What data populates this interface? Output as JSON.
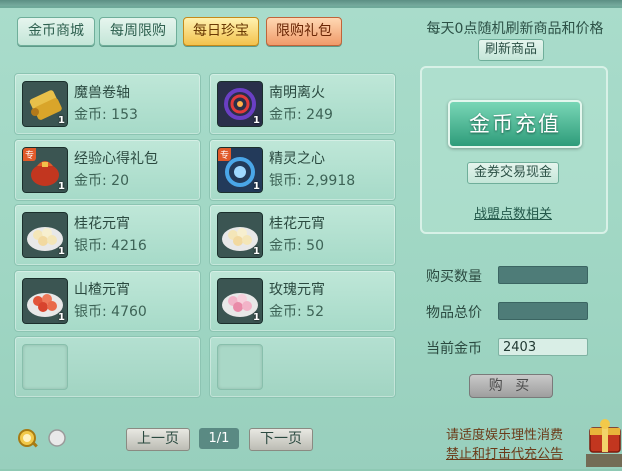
{
  "tabs": [
    {
      "label": "金币商城",
      "state": "normal"
    },
    {
      "label": "每周限购",
      "state": "normal"
    },
    {
      "label": "每日珍宝",
      "state": "active"
    },
    {
      "label": "限购礼包",
      "state": "limited"
    }
  ],
  "notice": "每天0点随机刷新商品和价格",
  "refresh_button": "刷新商品",
  "items": [
    {
      "name": "魔兽卷轴",
      "price": "金币: 153",
      "qty": "1",
      "icon": "scroll-icon"
    },
    {
      "name": "南明离火",
      "price": "金币: 249",
      "qty": "1",
      "icon": "fire-ring-icon"
    },
    {
      "name": "经验心得礼包",
      "price": "金币: 20",
      "qty": "1",
      "icon": "gift-bag-icon",
      "tag": "专"
    },
    {
      "name": "精灵之心",
      "price": "银币: 2,9918",
      "qty": "1",
      "icon": "spirit-heart-icon",
      "tag": "专"
    },
    {
      "name": "桂花元宵",
      "price": "银币: 4216",
      "qty": "1",
      "icon": "tangyuan-icon"
    },
    {
      "name": "桂花元宵",
      "price": "金币: 50",
      "qty": "1",
      "icon": "tangyuan-icon"
    },
    {
      "name": "山楂元宵",
      "price": "银币: 4760",
      "qty": "1",
      "icon": "hawthorn-tangyuan-icon"
    },
    {
      "name": "玫瑰元宵",
      "price": "金币: 52",
      "qty": "1",
      "icon": "rose-tangyuan-icon"
    }
  ],
  "recharge_button": "金币充值",
  "exchange_button": "金券交易现金",
  "alliance_link": "战盟点数相关",
  "purchase": {
    "quantity_label": "购买数量",
    "quantity_value": "",
    "total_label": "物品总价",
    "total_value": "",
    "balance_label": "当前金币",
    "balance_value": "2403"
  },
  "buy_button": "购 买",
  "pagination": {
    "prev": "上一页",
    "page": "1/1",
    "next": "下一页"
  },
  "footer": {
    "line1": "请适度娱乐理性消费",
    "line2": "禁止和打击代充公告"
  },
  "colors": {
    "panel": "#a9dccb",
    "active_tab": "#f3c24d",
    "limited_tab": "#f09b6a",
    "recharge": "#2e9c7a",
    "footer_text": "#6b3a18"
  }
}
